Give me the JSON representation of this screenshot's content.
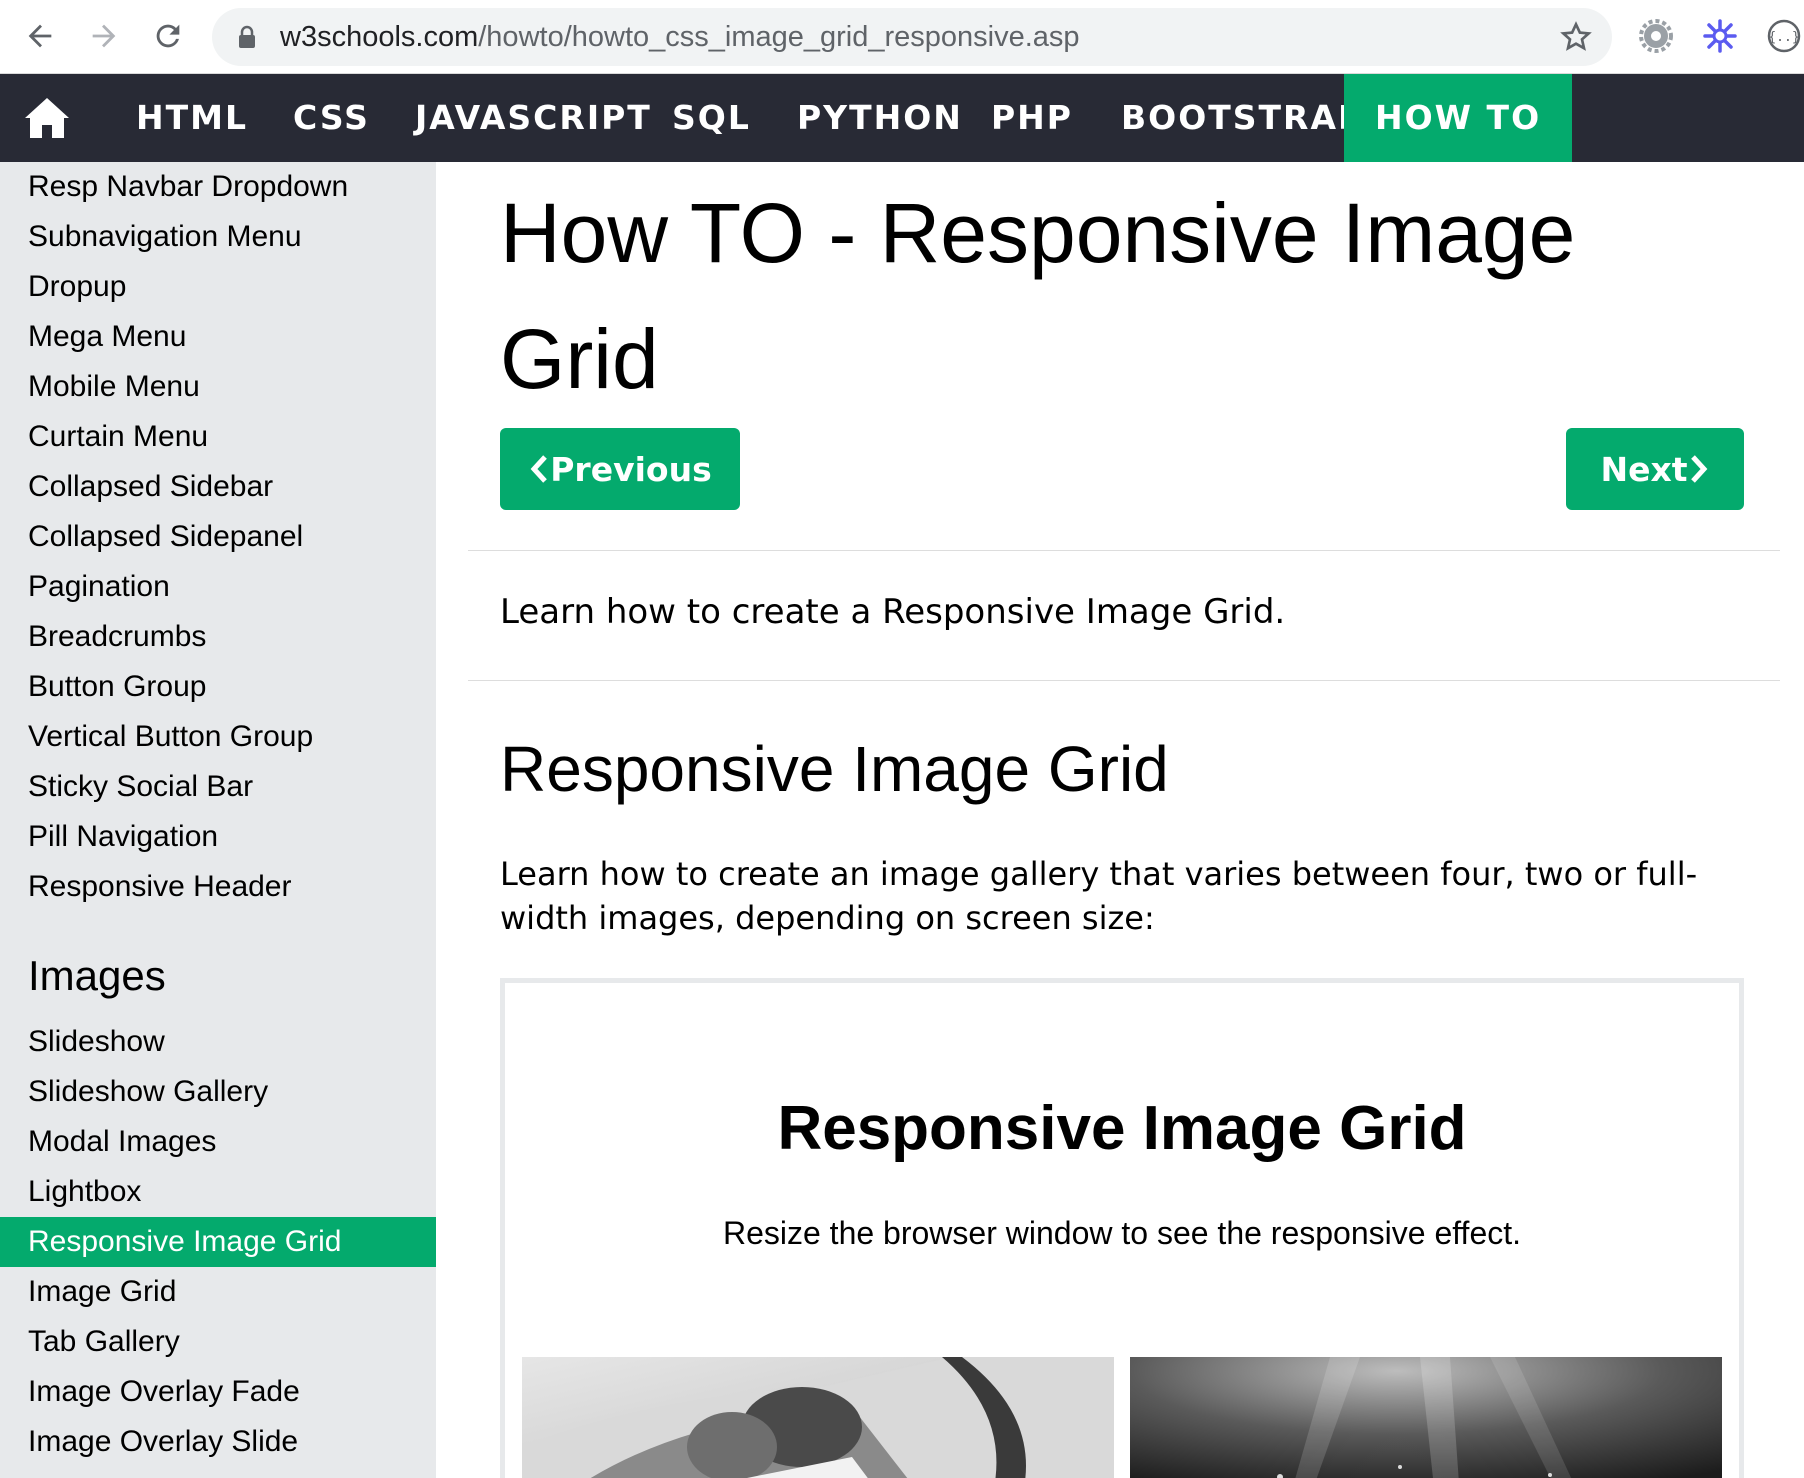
{
  "browser": {
    "url_host": "w3schools.com",
    "url_path": "/howto/howto_css_image_grid_responsive.asp"
  },
  "topnav": {
    "items": [
      {
        "label": "HTML"
      },
      {
        "label": "CSS"
      },
      {
        "label": "JAVASCRIPT"
      },
      {
        "label": "SQL"
      },
      {
        "label": "PYTHON"
      },
      {
        "label": "PHP"
      },
      {
        "label": "BOOTSTRAP"
      },
      {
        "label": "HOW TO",
        "active": true
      }
    ],
    "active_color": "#04aa6d",
    "background": "#282a35"
  },
  "sidebar": {
    "menus": [
      "Resp Navbar Dropdown",
      "Subnavigation Menu",
      "Dropup",
      "Mega Menu",
      "Mobile Menu",
      "Curtain Menu",
      "Collapsed Sidebar",
      "Collapsed Sidepanel",
      "Pagination",
      "Breadcrumbs",
      "Button Group",
      "Vertical Button Group",
      "Sticky Social Bar",
      "Pill Navigation",
      "Responsive Header"
    ],
    "images_heading": "Images",
    "images": [
      "Slideshow",
      "Slideshow Gallery",
      "Modal Images",
      "Lightbox",
      "Responsive Image Grid",
      "Image Grid",
      "Tab Gallery",
      "Image Overlay Fade",
      "Image Overlay Slide"
    ],
    "active_item": "Responsive Image Grid"
  },
  "main": {
    "title": "How TO - Responsive Image Grid",
    "prev_label": "Previous",
    "next_label": "Next",
    "intro": "Learn how to create a Responsive Image Grid.",
    "section_heading": "Responsive Image Grid",
    "description": "Learn how to create an image gallery that varies between four, two or full-width images, depending on screen size:",
    "example": {
      "title": "Responsive Image Grid",
      "subtitle": "Resize the browser window to see the responsive effect."
    }
  }
}
